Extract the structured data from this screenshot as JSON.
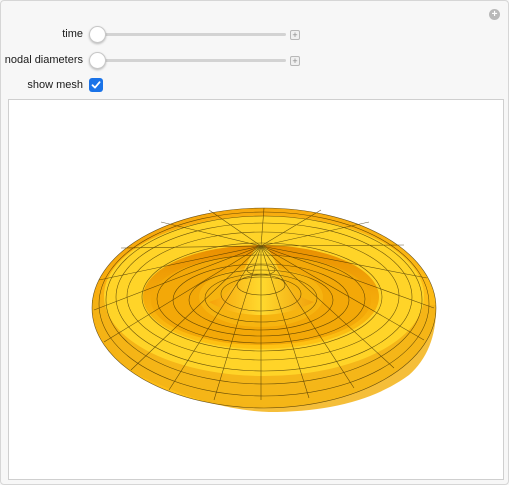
{
  "controls": {
    "time_label": "time",
    "nodal_label": "nodal diameters",
    "mesh_label": "show mesh",
    "time_value": 0,
    "nodal_value": 0,
    "show_mesh": true
  },
  "icons": {
    "reset": "plus-circle-icon",
    "time_increment": "plus-icon",
    "nodal_increment": "plus-icon",
    "checkbox": "checkmark-icon"
  },
  "colors": {
    "surface_light": "#ffd21a",
    "surface_dark": "#e58a00",
    "mesh": "#3a2a00",
    "checkbox": "#1a73e8"
  }
}
